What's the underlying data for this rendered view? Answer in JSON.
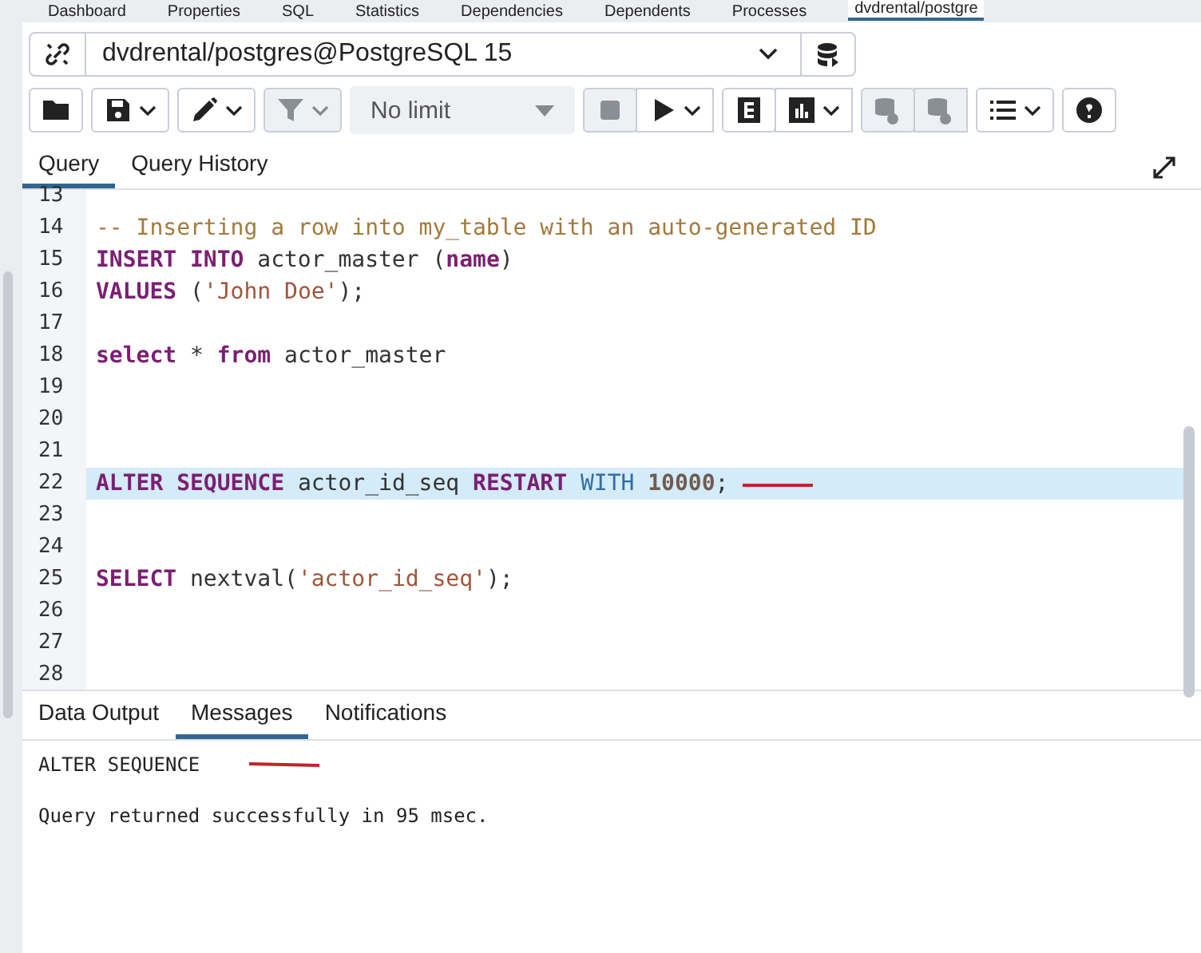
{
  "top_tabs": [
    {
      "label": "Dashboard",
      "selected": false
    },
    {
      "label": "Properties",
      "selected": false
    },
    {
      "label": "SQL",
      "selected": false
    },
    {
      "label": "Statistics",
      "selected": false
    },
    {
      "label": "Dependencies",
      "selected": false
    },
    {
      "label": "Dependents",
      "selected": false
    },
    {
      "label": "Processes",
      "selected": false
    },
    {
      "label": "dvdrental/postgre",
      "selected": true
    }
  ],
  "connection": {
    "value": "dvdrental/postgres@PostgreSQL 15"
  },
  "toolbar": [
    {
      "kind": "folder",
      "disabled": false,
      "caret": false
    },
    {
      "kind": "save",
      "disabled": false,
      "caret": true
    },
    {
      "kind": "pencil",
      "disabled": false,
      "caret": true
    },
    {
      "kind": "filter",
      "disabled": true,
      "caret": true
    },
    {
      "kind": "limit",
      "disabled": true,
      "caret": true,
      "value": "No limit"
    },
    {
      "kind": "stop",
      "disabled": true,
      "caret": false
    },
    {
      "kind": "play",
      "disabled": false,
      "caret": true
    },
    {
      "kind": "explain",
      "disabled": false,
      "caret": false
    },
    {
      "kind": "chart",
      "disabled": false,
      "caret": true
    },
    {
      "kind": "commit",
      "disabled": true,
      "caret": false
    },
    {
      "kind": "rollback",
      "disabled": true,
      "caret": false
    },
    {
      "kind": "macros",
      "disabled": false,
      "caret": true
    },
    {
      "kind": "help",
      "disabled": false,
      "caret": false
    }
  ],
  "query_tabs": [
    {
      "label": "Query",
      "selected": true
    },
    {
      "label": "Query History",
      "selected": false
    }
  ],
  "editor": {
    "lines": [
      {
        "number": "13",
        "selected": false
      },
      {
        "number": "14",
        "selected": false,
        "tokens": [
          {
            "kind": "comment",
            "text": "-- Inserting a row into my_table with an auto-generated ID"
          }
        ]
      },
      {
        "number": "15",
        "selected": false,
        "tokens": [
          {
            "kind": "keyword",
            "text": "INSERT INTO"
          },
          {
            "kind": "plain",
            "text": " actor_master ("
          },
          {
            "kind": "keyword",
            "text": "name"
          },
          {
            "kind": "plain",
            "text": ")"
          }
        ]
      },
      {
        "number": "16",
        "selected": false,
        "tokens": [
          {
            "kind": "keyword",
            "text": "VALUES"
          },
          {
            "kind": "plain",
            "text": " ("
          },
          {
            "kind": "string",
            "text": "'John Doe'"
          },
          {
            "kind": "plain",
            "text": ");"
          }
        ]
      },
      {
        "number": "17",
        "selected": false
      },
      {
        "number": "18",
        "selected": false,
        "tokens": [
          {
            "kind": "keyword",
            "text": "select"
          },
          {
            "kind": "plain",
            "text": " * "
          },
          {
            "kind": "keyword",
            "text": "from"
          },
          {
            "kind": "plain",
            "text": " actor_master"
          }
        ]
      },
      {
        "number": "19",
        "selected": false
      },
      {
        "number": "20",
        "selected": false
      },
      {
        "number": "21",
        "selected": false
      },
      {
        "number": "22",
        "selected": true,
        "tokens": [
          {
            "kind": "keyword",
            "text": "ALTER SEQUENCE"
          },
          {
            "kind": "plain",
            "text": " actor_id_seq "
          },
          {
            "kind": "keyword",
            "text": "RESTART"
          },
          {
            "kind": "builtin",
            "text": " WITH"
          },
          {
            "kind": "number",
            "text": " 10000"
          },
          {
            "kind": "plain",
            "text": ";"
          }
        ]
      },
      {
        "number": "23",
        "selected": false
      },
      {
        "number": "24",
        "selected": false
      },
      {
        "number": "25",
        "selected": false,
        "tokens": [
          {
            "kind": "keyword",
            "text": "SELECT"
          },
          {
            "kind": "plain",
            "text": " nextval("
          },
          {
            "kind": "string",
            "text": "'actor_id_seq'"
          },
          {
            "kind": "plain",
            "text": ");"
          }
        ]
      },
      {
        "number": "26",
        "selected": false
      },
      {
        "number": "27",
        "selected": false
      },
      {
        "number": "28",
        "selected": false
      }
    ]
  },
  "output_tabs": [
    {
      "label": "Data Output",
      "selected": false
    },
    {
      "label": "Messages",
      "selected": true
    },
    {
      "label": "Notifications",
      "selected": false
    }
  ],
  "messages": [
    "ALTER SEQUENCE",
    "Query returned successfully in 95 msec."
  ]
}
